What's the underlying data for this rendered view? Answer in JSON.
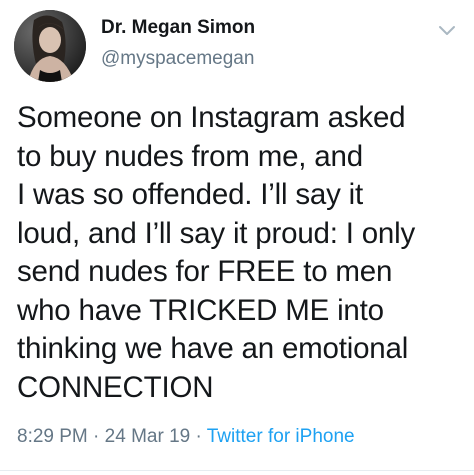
{
  "author": {
    "name": "Dr. Megan Simon",
    "handle": "@myspacemegan"
  },
  "tweet": {
    "text": "Someone on Instagram asked\nto buy nudes from me, and\nI was so offended. I’ll say it\nloud, and I’ll say it proud: I only\nsend nudes for FREE to men\nwho have TRICKED ME into\nthinking we have an emotional\nCONNECTION",
    "time": "8:29 PM",
    "date": "24 Mar 19",
    "separator": "·",
    "source": "Twitter for iPhone"
  },
  "icons": {
    "menu": "chevron-down-icon",
    "avatar": "profile-photo"
  },
  "colors": {
    "text": "#14171a",
    "secondary": "#657786",
    "link": "#1da1f2"
  }
}
